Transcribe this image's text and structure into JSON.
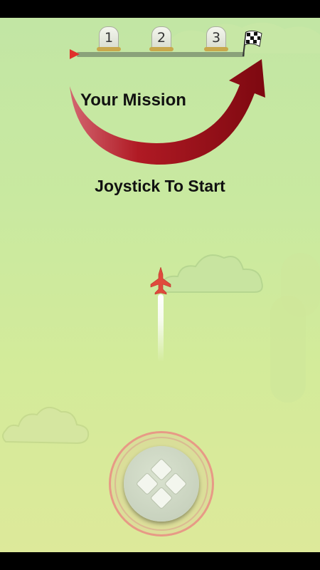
{
  "hud": {
    "checkpoints": [
      "1",
      "2",
      "3"
    ],
    "mission_label": "Your Mission",
    "start_prompt": "Joystick To Start"
  },
  "icons": {
    "start_marker": "red-arrow-marker",
    "finish": "checkered-flag",
    "mission_arrow": "curved-red-arrow",
    "player": "red-jet-plane",
    "control": "dpad-joystick"
  },
  "colors": {
    "sky_top": "#c2e6a4",
    "sky_bottom": "#dde99a",
    "arrow": "#8b0a10",
    "plane": "#e04a3c",
    "joystick_ring": "#e79a86"
  }
}
